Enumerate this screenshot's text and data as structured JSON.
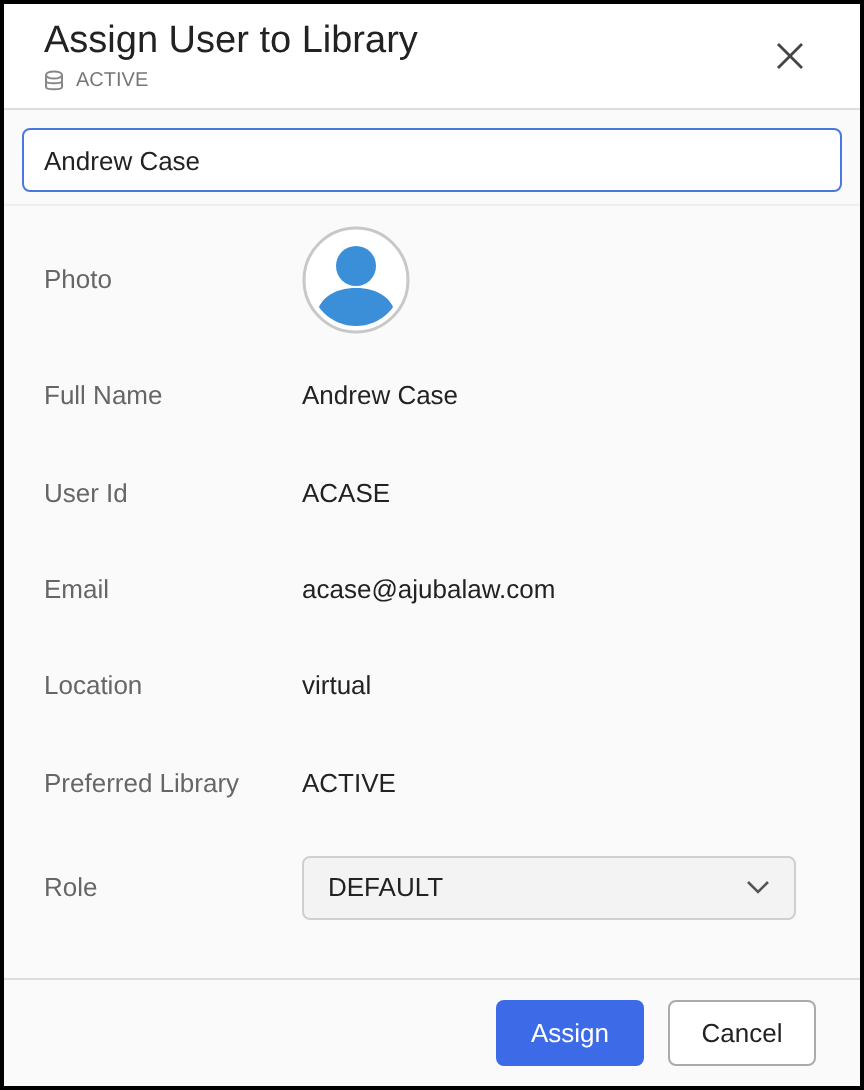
{
  "dialog": {
    "title": "Assign User to Library",
    "subtitle": "ACTIVE"
  },
  "search": {
    "value": "Andrew Case"
  },
  "fields": [
    {
      "kind": "photo",
      "label": "Photo"
    },
    {
      "kind": "text",
      "label": "Full Name",
      "value": "Andrew Case"
    },
    {
      "kind": "text",
      "label": "User Id",
      "value": "ACASE"
    },
    {
      "kind": "text",
      "label": "Email",
      "value": "acase@ajubalaw.com"
    },
    {
      "kind": "text",
      "label": "Location",
      "value": "virtual"
    },
    {
      "kind": "text",
      "label": "Preferred Library",
      "value": "ACTIVE"
    },
    {
      "kind": "select",
      "label": "Role",
      "value": "DEFAULT"
    }
  ],
  "buttons": [
    {
      "label": "Assign",
      "kind": "primary"
    },
    {
      "label": "Cancel",
      "kind": "secondary"
    }
  ]
}
